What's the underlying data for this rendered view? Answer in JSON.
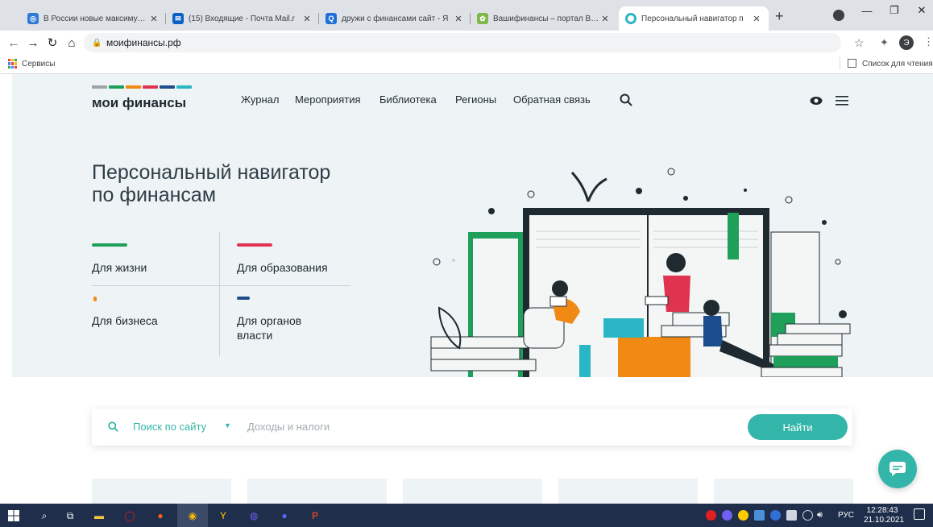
{
  "browser": {
    "tabs": [
      {
        "title": "В России новые максимумы",
        "favicon_color": "#2e7bd6"
      },
      {
        "title": "(15) Входящие - Почта Mail.r",
        "favicon_color": "#0a5fc5"
      },
      {
        "title": "дружи с финансами сайт - Я",
        "favicon_color": "#1f6fd8"
      },
      {
        "title": "Вашифинансы – портал Ваш",
        "favicon_color": "#7fb848"
      },
      {
        "title": "Персональный навигатор п",
        "favicon_color": "#ffffff"
      }
    ],
    "url": "моифинансы.рф",
    "bookmarks_label": "Сервисы",
    "reading_list_label": "Список для чтения",
    "profile_initial": "Э"
  },
  "site": {
    "logo_text": "мои финансы",
    "logo_colors": [
      "#9ea3a6",
      "#1fa05a",
      "#f08a14",
      "#e0334f",
      "#1b4d8c",
      "#2ab6c4"
    ],
    "nav": [
      "Журнал",
      "Мероприятия",
      "Библиотека",
      "Регионы",
      "Обратная связь"
    ],
    "hero_title_line1": "Персональный навигатор",
    "hero_title_line2": "по финансам",
    "categories": [
      {
        "label_line1": "Для жизни",
        "label_line2": "",
        "color": "#1fa05a"
      },
      {
        "label_line1": "Для образования",
        "label_line2": "",
        "color": "#e0334f"
      },
      {
        "label_line1": "Для бизнеса",
        "label_line2": "",
        "color": "#f08a14"
      },
      {
        "label_line1": "Для органов",
        "label_line2": "власти",
        "color": "#1b4d8c"
      }
    ],
    "search": {
      "scope": "Поиск по сайту",
      "placeholder": "Доходы и налоги",
      "button": "Найти"
    },
    "accent": "#33b5a9"
  },
  "taskbar": {
    "language": "РУС",
    "time": "12:28:43",
    "date": "21.10.2021"
  }
}
